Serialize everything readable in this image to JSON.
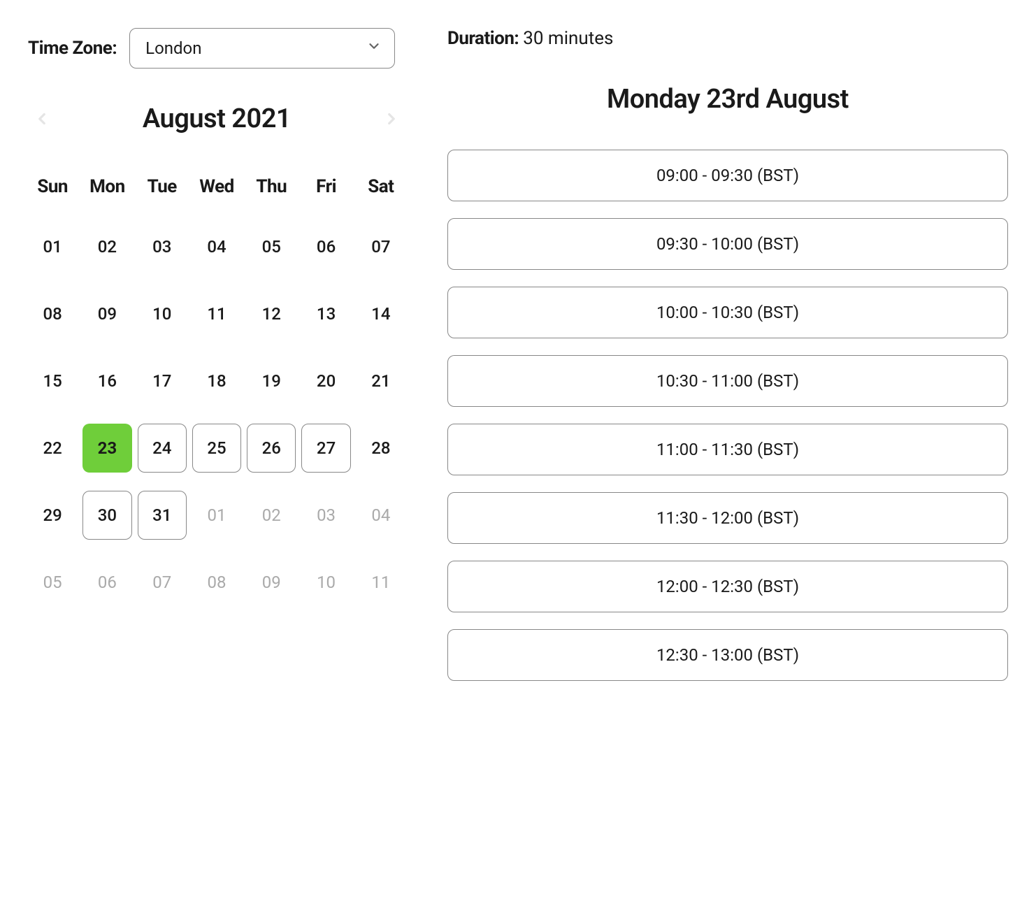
{
  "timezone": {
    "label": "Time Zone:",
    "selected": "London"
  },
  "duration": {
    "label": "Duration:",
    "value": "30 minutes"
  },
  "calendar": {
    "month_title": "August 2021",
    "dow": [
      "Sun",
      "Mon",
      "Tue",
      "Wed",
      "Thu",
      "Fri",
      "Sat"
    ],
    "days": [
      {
        "n": "01",
        "state": "normal"
      },
      {
        "n": "02",
        "state": "normal"
      },
      {
        "n": "03",
        "state": "normal"
      },
      {
        "n": "04",
        "state": "normal"
      },
      {
        "n": "05",
        "state": "normal"
      },
      {
        "n": "06",
        "state": "normal"
      },
      {
        "n": "07",
        "state": "normal"
      },
      {
        "n": "08",
        "state": "normal"
      },
      {
        "n": "09",
        "state": "normal"
      },
      {
        "n": "10",
        "state": "normal"
      },
      {
        "n": "11",
        "state": "normal"
      },
      {
        "n": "12",
        "state": "normal"
      },
      {
        "n": "13",
        "state": "normal"
      },
      {
        "n": "14",
        "state": "normal"
      },
      {
        "n": "15",
        "state": "normal"
      },
      {
        "n": "16",
        "state": "normal"
      },
      {
        "n": "17",
        "state": "normal"
      },
      {
        "n": "18",
        "state": "normal"
      },
      {
        "n": "19",
        "state": "normal"
      },
      {
        "n": "20",
        "state": "normal"
      },
      {
        "n": "21",
        "state": "normal"
      },
      {
        "n": "22",
        "state": "normal"
      },
      {
        "n": "23",
        "state": "selected"
      },
      {
        "n": "24",
        "state": "available"
      },
      {
        "n": "25",
        "state": "available"
      },
      {
        "n": "26",
        "state": "available"
      },
      {
        "n": "27",
        "state": "available"
      },
      {
        "n": "28",
        "state": "normal"
      },
      {
        "n": "29",
        "state": "normal"
      },
      {
        "n": "30",
        "state": "available"
      },
      {
        "n": "31",
        "state": "available"
      },
      {
        "n": "01",
        "state": "other"
      },
      {
        "n": "02",
        "state": "other"
      },
      {
        "n": "03",
        "state": "other"
      },
      {
        "n": "04",
        "state": "other"
      },
      {
        "n": "05",
        "state": "other"
      },
      {
        "n": "06",
        "state": "other"
      },
      {
        "n": "07",
        "state": "other"
      },
      {
        "n": "08",
        "state": "other"
      },
      {
        "n": "09",
        "state": "other"
      },
      {
        "n": "10",
        "state": "other"
      },
      {
        "n": "11",
        "state": "other"
      }
    ]
  },
  "selected_day": {
    "title": "Monday 23rd August"
  },
  "slots": [
    "09:00 - 09:30 (BST)",
    "09:30 - 10:00 (BST)",
    "10:00 - 10:30 (BST)",
    "10:30 - 11:00 (BST)",
    "11:00 - 11:30 (BST)",
    "11:30 - 12:00 (BST)",
    "12:00 - 12:30 (BST)",
    "12:30 - 13:00 (BST)"
  ]
}
